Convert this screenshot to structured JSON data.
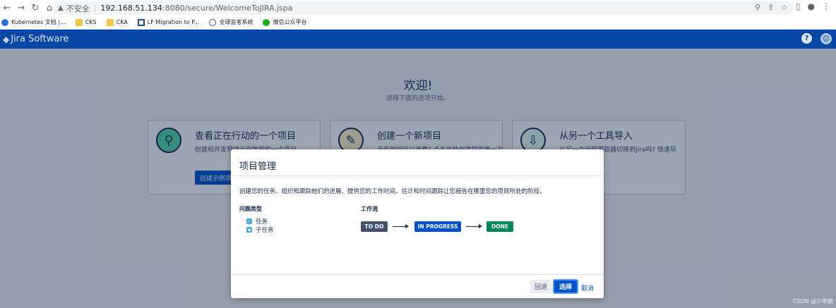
{
  "browser": {
    "insecure_label": "不安全",
    "url_host": "192.168.51.134",
    "url_path": ":8080/secure/WelcomeToJIRA.jspa",
    "bookmarks": [
      {
        "label": "Kubernetes 文档 |...",
        "icon": "kubernetes-icon"
      },
      {
        "label": "CKS",
        "icon": "folder-icon"
      },
      {
        "label": "CKA",
        "icon": "folder-icon"
      },
      {
        "label": "LF Migration to P...",
        "icon": "lf-icon"
      },
      {
        "label": "全球监考系统",
        "icon": "globe-icon"
      },
      {
        "label": "微信公众平台",
        "icon": "wechat-icon"
      }
    ]
  },
  "header": {
    "product_name": "Jira Software",
    "help_glyph": "?"
  },
  "welcome": {
    "title": "欢迎!",
    "subtitle": "选择下面的选项开始。"
  },
  "cards": [
    {
      "title": "查看正在行动的一个项目",
      "desc": "创建和开发预填示例数据的一个项目",
      "button": "创建示例项"
    },
    {
      "title": "创建一个新项目",
      "desc": "没有时间可以浪费? 点击此处创建您的第一次"
    },
    {
      "title": "从另一个工具导入",
      "desc": "从另一个问题跟踪器切换到Jira吗? 快速导"
    }
  ],
  "dialog": {
    "title": "项目管理",
    "description": "创建您的任务、组织和跟踪他们的进展、提供您的工作时间。估计和时间跟踪让您报告在哪里您的项目所处的阶段。",
    "issue_types_label": "问题类型",
    "issue_types": [
      "任务",
      "子任务"
    ],
    "workflow_label": "工作流",
    "workflow": [
      "TO DO",
      "IN PROGRESS",
      "DONE"
    ],
    "back_label": "回退",
    "select_label": "选择",
    "cancel_label": "取消"
  },
  "watermark": "CSDN @少年痕"
}
